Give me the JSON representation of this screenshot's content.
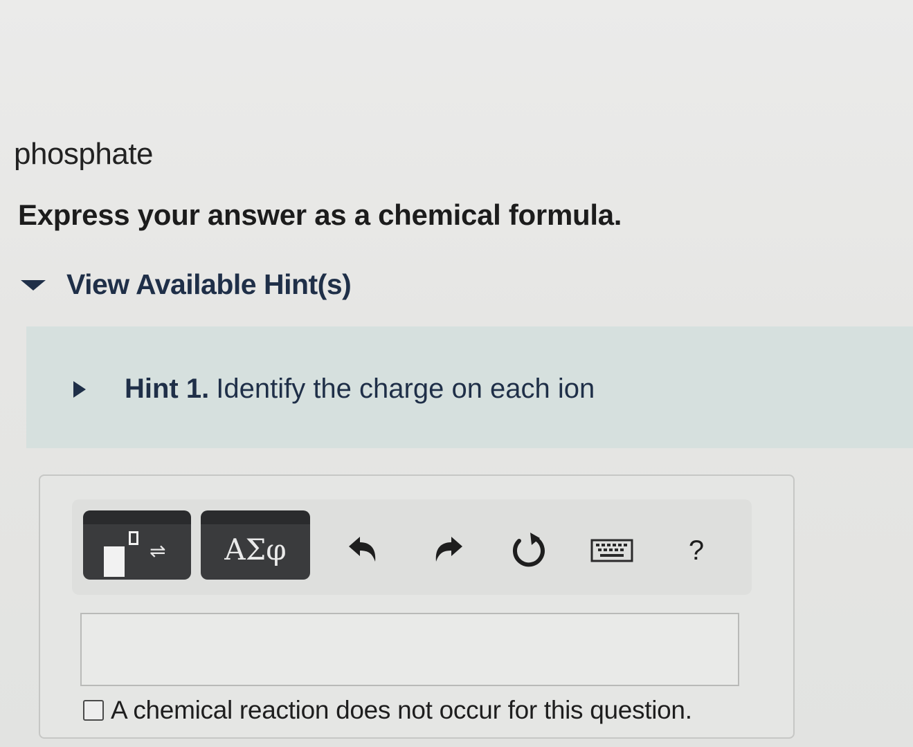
{
  "question": {
    "item_name": "phosphate",
    "instruction": "Express your answer as a chemical formula."
  },
  "hints": {
    "toggle_label": "View Available Hint(s)",
    "items": [
      {
        "number": "Hint 1.",
        "text": "Identify the charge on each ion"
      }
    ]
  },
  "toolbar": {
    "symbols_label": "ΑΣφ",
    "templates_arrows": "⇌",
    "help_label": "?",
    "icons": [
      "templates-icon",
      "undo-icon",
      "redo-icon",
      "reset-icon",
      "keyboard-icon",
      "help-icon"
    ]
  },
  "answer": {
    "value": "",
    "placeholder": ""
  },
  "no_reaction": {
    "label": "A chemical reaction does not occur for this question.",
    "checked": false
  },
  "colors": {
    "hint_text": "#1f2f48",
    "hint_panel": "#d6e0de",
    "toolbar_button": "#3a3b3d"
  }
}
